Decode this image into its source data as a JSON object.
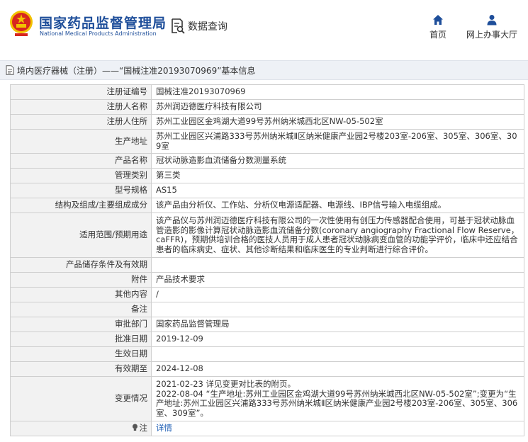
{
  "header": {
    "brand_cn": "国家药品监督管理局",
    "brand_en": "National Medical Products Administration",
    "data_query": "数据查询",
    "nav": [
      {
        "label": "首页",
        "icon": "home-icon"
      },
      {
        "label": "网上办事大厅",
        "icon": "user-icon"
      }
    ]
  },
  "breadcrumb": {
    "text": "境内医疗器械（注册）——“国械注准20193070969”基本信息"
  },
  "colors": {
    "brand_blue": "#1e4e9a",
    "logo_red": "#d7261e",
    "logo_gold": "#f2c200",
    "link": "#1f5fb5",
    "label_bg": "#f2f2f2",
    "border": "#cfcfcf"
  },
  "details": [
    {
      "label": "注册证编号",
      "value": "国械注准20193070969"
    },
    {
      "label": "注册人名称",
      "value": "苏州润迈德医疗科技有限公司"
    },
    {
      "label": "注册人住所",
      "value": "苏州工业园区金鸡湖大道99号苏州纳米城西北区NW-05-502室"
    },
    {
      "label": "生产地址",
      "value": "苏州工业园区兴浦路333号苏州纳米城Ⅱ区纳米健康产业园2号楼203室-206室、305室、306室、309室"
    },
    {
      "label": "产品名称",
      "value": "冠状动脉造影血流储备分数测量系统"
    },
    {
      "label": "管理类别",
      "value": "第三类"
    },
    {
      "label": "型号规格",
      "value": "AS15"
    },
    {
      "label": "结构及组成/主要组成成分",
      "value": "该产品由分析仪、工作站、分析仪电源适配器、电源线、IBP信号输入电缆组成。"
    },
    {
      "label": "适用范围/预期用途",
      "value": "该产品仪与苏州润迈德医疗科技有限公司的一次性使用有创压力传感器配合使用，可基于冠状动脉血管造影的影像计算冠状动脉造影血流储备分数(coronary angiography Fractional Flow Reserve，caFFR)，预期供培训合格的医技人员用于成人患者冠状动脉病变血管的功能学评价，临床中还应结合患者的临床病史、症状、其他诊断结果和临床医生的专业判断进行综合评价。"
    },
    {
      "label": "产品储存条件及有效期",
      "value": ""
    },
    {
      "label": "附件",
      "value": "产品技术要求"
    },
    {
      "label": "其他内容",
      "value": "/"
    },
    {
      "label": "备注",
      "value": ""
    },
    {
      "label": "审批部门",
      "value": "国家药品监督管理局"
    },
    {
      "label": "批准日期",
      "value": "2019-12-09"
    },
    {
      "label": "生效日期",
      "value": ""
    },
    {
      "label": "有效期至",
      "value": "2024-12-08"
    },
    {
      "label": "变更情况",
      "value_lines": [
        "2021-02-23 详见变更对比表的附页。",
        "2022-08-04 “生产地址:苏州工业园区金鸡湖大道99号苏州纳米城西北区NW-05-502室”;变更为“生产地址:苏州工业园区兴浦路333号苏州纳米城Ⅱ区纳米健康产业园2号楼203室-206室、305室、306室、309室”。"
      ]
    },
    {
      "label": "注",
      "value": "详情",
      "icon": "lightbulb-icon"
    }
  ]
}
